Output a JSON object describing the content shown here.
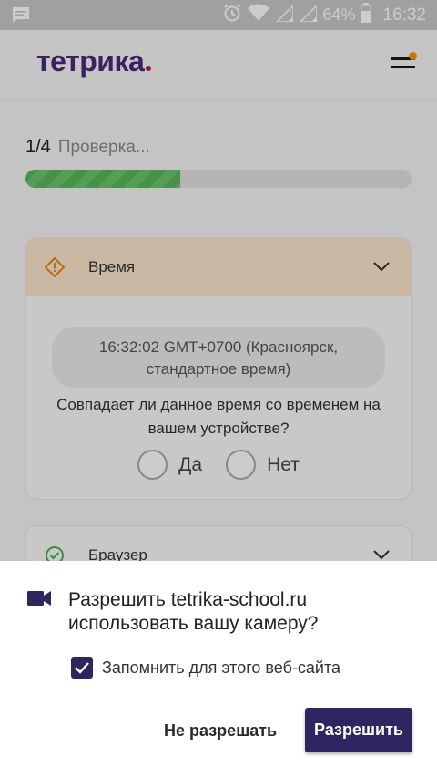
{
  "status_bar": {
    "battery": "64%",
    "time": "16:32",
    "icons": [
      "message-icon",
      "alarm-icon",
      "wifi-icon",
      "signal-icon",
      "signal-icon",
      "battery-icon"
    ]
  },
  "header": {
    "logo": "тетрика",
    "brand_color": "#4b2a7b",
    "accent_color": "#c2185b",
    "menu_icon": "hamburger-menu-icon",
    "notification_color": "#ff9800"
  },
  "progress": {
    "step": "1/4",
    "label": "Проверка...",
    "value": 0.4,
    "color": "#58b85a"
  },
  "cards": {
    "time": {
      "title": "Время",
      "status_icon": "warning-icon",
      "time_line1": "16:32:02 GMT+0700 (Красноярск,",
      "time_line2": "стандартное время)",
      "question_line1": "Совпадает ли данное время со временем на",
      "question_line2": "вашем устройстве?",
      "option_yes": "Да",
      "option_no": "Нет"
    },
    "browser": {
      "title": "Браузер",
      "status_icon": "check-circle-icon"
    }
  },
  "permission": {
    "title_line1": "Разрешить tetrika-school.ru",
    "title_line2": "использовать вашу камеру?",
    "remember_label": "Запомнить для этого веб-сайта",
    "remember_checked": true,
    "deny_label": "Не разрешать",
    "allow_label": "Разрешить",
    "accent_color": "#2e2660",
    "icon": "camera-icon"
  }
}
